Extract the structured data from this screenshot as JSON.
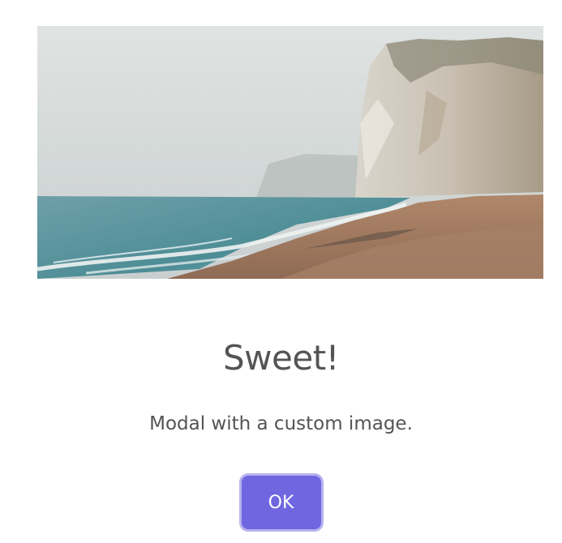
{
  "modal": {
    "image_description": "coastal-cliff-photo",
    "title": "Sweet!",
    "text": "Modal with a custom image.",
    "confirm_label": "OK"
  },
  "colors": {
    "confirm_button": "#7066e0",
    "text": "#545454",
    "background": "#ffffff"
  }
}
